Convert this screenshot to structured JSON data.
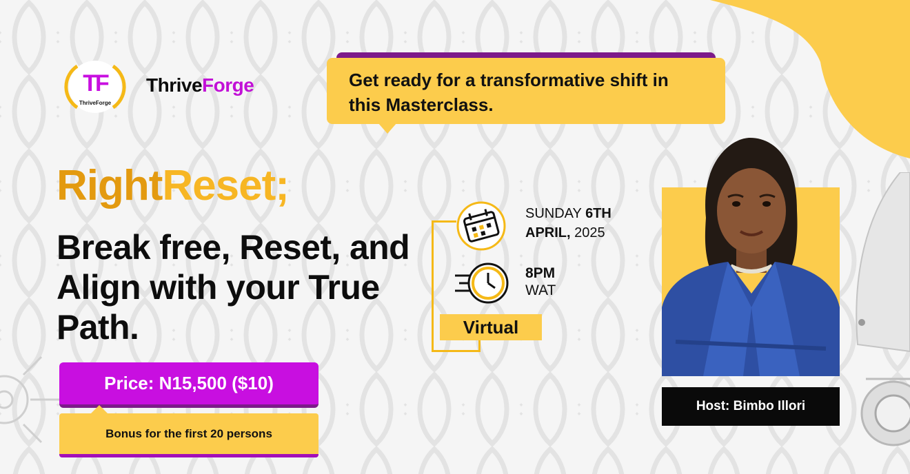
{
  "brand": {
    "badge_letters": "TF",
    "badge_caption": "ThriveForge",
    "name_part1": "Thrive",
    "name_part2": "Forge"
  },
  "bubble": {
    "text": "Get ready for a transformative shift in this Masterclass."
  },
  "headline": {
    "part1": "Right",
    "part2": "Reset;",
    "subtitle": "Break free, Reset, and Align with your True Path."
  },
  "event": {
    "date_day": "SUNDAY ",
    "date_num": "6TH",
    "date_month": "APRIL,",
    "date_year": " 2025",
    "time": "8PM",
    "timezone": "WAT",
    "mode": "Virtual"
  },
  "pricing": {
    "price": "Price: N15,500 ($10)",
    "bonus": "Bonus for the first 20 persons"
  },
  "host": {
    "label": "Host: Bimbo Illori"
  },
  "colors": {
    "yellow": "#fccc4c",
    "magenta": "#c80fe0",
    "purple": "#7d1a8a",
    "orange": "#e39a10",
    "black": "#0a0a0a"
  },
  "icons": [
    "calendar-icon",
    "clock-icon",
    "gear-icon",
    "rocket-icon"
  ]
}
